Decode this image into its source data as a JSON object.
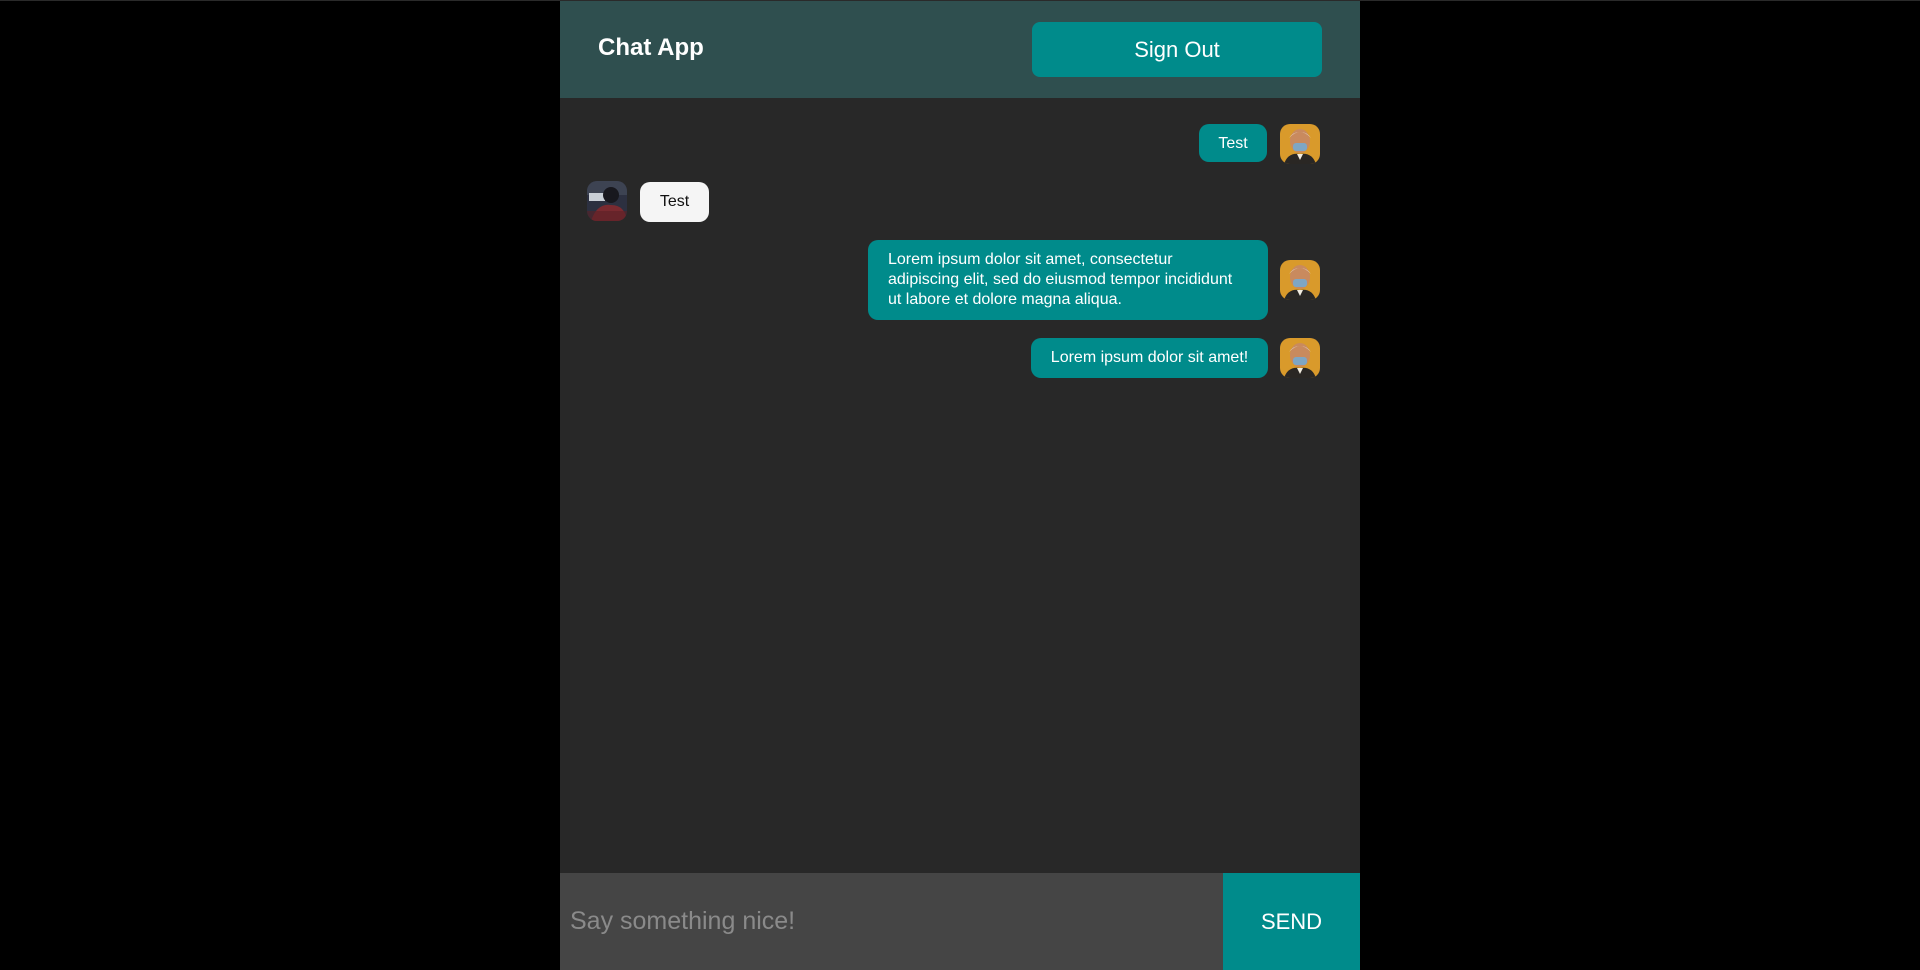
{
  "header": {
    "title": "Chat App",
    "sign_out_label": "Sign Out"
  },
  "messages": [
    {
      "direction": "sent",
      "text": "Test",
      "avatar": "user-avatar-portrait"
    },
    {
      "direction": "received",
      "text": "Test",
      "avatar": "contact-avatar-photo"
    },
    {
      "direction": "sent",
      "text": "Lorem ipsum dolor sit amet, consectetur adipiscing elit, sed do eiusmod tempor incididunt ut labore et dolore magna aliqua.",
      "avatar": "user-avatar-portrait"
    },
    {
      "direction": "sent",
      "text": "Lorem ipsum dolor sit amet!",
      "avatar": "user-avatar-portrait"
    }
  ],
  "composer": {
    "placeholder": "Say something nice!",
    "value": "",
    "send_label": "SEND"
  },
  "colors": {
    "accent": "#008b8b",
    "header_bg": "#2f4f4f",
    "chat_bg": "#282828",
    "input_bg": "#454545"
  }
}
